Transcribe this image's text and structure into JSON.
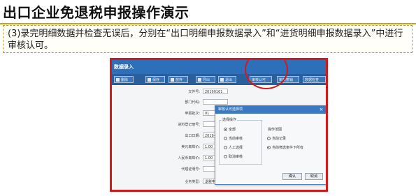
{
  "slide": {
    "title": "出口企业免退税申报操作演示",
    "description": "(3)录完明细数据并检查无误后，分别在“出口明细申报数据录入”和“进货明细申报数据录入”中进行审核认可。"
  },
  "window": {
    "title": "数据录入"
  },
  "toolbar": {
    "buttons": [
      {
        "label": "删除",
        "icon": "trash-icon"
      },
      {
        "label": "保存",
        "icon": "save-icon"
      },
      {
        "label": "放弃",
        "icon": "cancel-icon"
      },
      {
        "label": "导出",
        "icon": "export-icon"
      },
      {
        "label": "退出",
        "icon": "exit-icon"
      },
      {
        "label": "审核认可",
        "icon": ""
      },
      {
        "label": "审核撤销",
        "icon": ""
      },
      {
        "label": "数据检查",
        "icon": ""
      }
    ]
  },
  "form": {
    "fields": [
      {
        "label": "文件号:",
        "value": "20190101"
      },
      {
        "label": "部门代码:",
        "value": ""
      },
      {
        "label": "申报批次:",
        "value": "01"
      },
      {
        "label": "进料登记册号:",
        "value": ""
      },
      {
        "label": "出口日期:",
        "value": "2019-01"
      },
      {
        "label": "美元离岸价:",
        "value": "1.00"
      },
      {
        "label": "人民币离岸价:",
        "value": "1.00"
      },
      {
        "label": "代理证明号:",
        "value": ""
      },
      {
        "label": "业务类型:",
        "value": "退税申报"
      }
    ]
  },
  "dialog": {
    "title": "审核认可选择项",
    "scope_group_title": "选择操作",
    "scope_options": [
      {
        "label": "全部",
        "selected": true
      },
      {
        "label": "当前审核",
        "selected": false
      },
      {
        "label": "人工选择",
        "selected": false
      },
      {
        "label": "取消审核",
        "selected": false
      }
    ],
    "mode_group_title": "操作范围",
    "mode_options": [
      {
        "label": "当前记录",
        "selected": false
      },
      {
        "label": "当前筛选条件下所有",
        "selected": true
      }
    ],
    "ok_label": "确认",
    "cancel_label": "取消"
  }
}
